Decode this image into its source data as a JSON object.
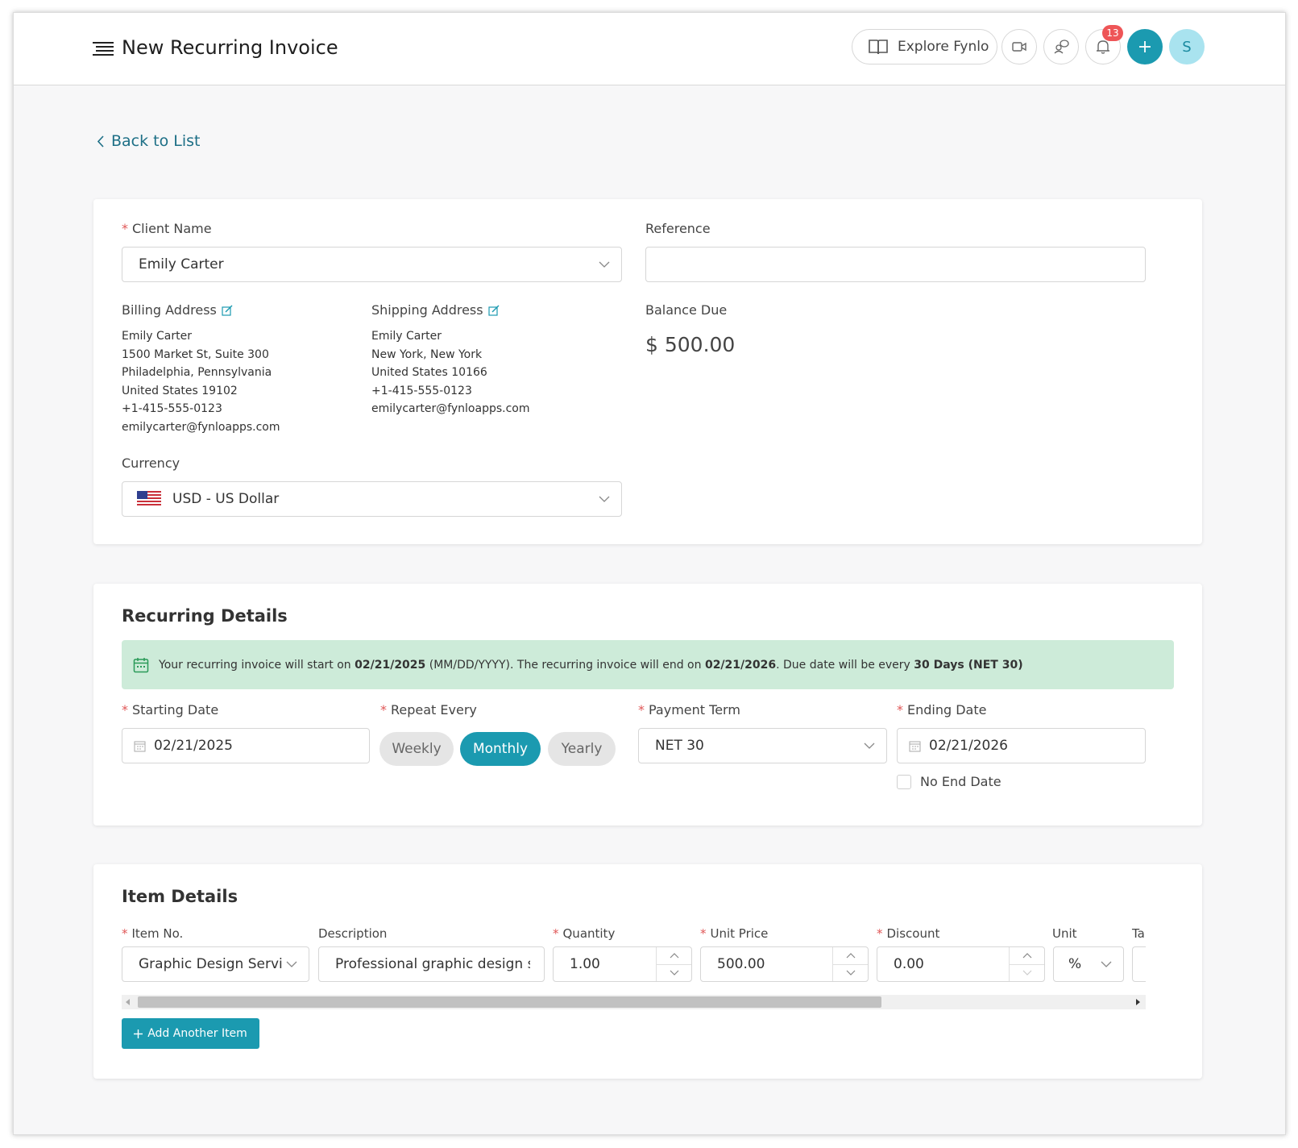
{
  "header": {
    "title": "New Recurring Invoice",
    "explore_label": "Explore Fynlo",
    "notification_count": "13",
    "avatar_initial": "S"
  },
  "nav": {
    "back_label": "Back to List"
  },
  "client": {
    "client_name_label": "Client Name",
    "client_name_value": "Emily Carter",
    "reference_label": "Reference",
    "reference_value": "",
    "billing_label": "Billing Address",
    "billing_lines": [
      "Emily Carter",
      "1500 Market St, Suite 300",
      "Philadelphia, Pennsylvania",
      "United States 19102",
      "+1-415-555-0123",
      "emilycarter@fynloapps.com"
    ],
    "shipping_label": "Shipping Address",
    "shipping_lines": [
      "Emily Carter",
      "New York, New York",
      "United States 10166",
      "+1-415-555-0123",
      "emilycarter@fynloapps.com"
    ],
    "balance_label": "Balance Due",
    "balance_value": "$ 500.00",
    "currency_label": "Currency",
    "currency_value": "USD - US Dollar"
  },
  "recurring": {
    "title": "Recurring Details",
    "notice": {
      "t1": "Your recurring invoice will start on ",
      "start": "02/21/2025",
      "t2": " (MM/DD/YYYY). The recurring invoice will end on ",
      "end": "02/21/2026",
      "t3": ". Due date will be every ",
      "term": "30 Days (NET 30)"
    },
    "starting_date_label": "Starting Date",
    "starting_date_value": "02/21/2025",
    "repeat_label": "Repeat Every",
    "repeat_options": [
      "Weekly",
      "Monthly",
      "Yearly"
    ],
    "repeat_selected": "Monthly",
    "payment_term_label": "Payment Term",
    "payment_term_value": "NET 30",
    "ending_date_label": "Ending Date",
    "ending_date_value": "02/21/2026",
    "no_end_label": "No End Date",
    "no_end_checked": false
  },
  "items": {
    "title": "Item Details",
    "columns": {
      "item_no": "Item No.",
      "description": "Description",
      "quantity": "Quantity",
      "unit_price": "Unit Price",
      "discount": "Discount",
      "unit": "Unit",
      "tax_partial": "Ta"
    },
    "row": {
      "item_no": "Graphic Design Services",
      "description": "Professional graphic design services",
      "quantity": "1.00",
      "unit_price": "500.00",
      "discount": "0.00",
      "unit": "%"
    },
    "scroll_fraction": 0.73,
    "add_label": "Add Another Item"
  },
  "colors": {
    "accent": "#1b9ab0",
    "notice_bg": "#cdebd9",
    "required": "#e05757",
    "badge": "#ee5557"
  },
  "icons": [
    "menu-icon",
    "book-icon",
    "video-icon",
    "support-icon",
    "bell-icon",
    "plus-icon",
    "chevron-left-icon",
    "edit-icon",
    "chevron-down-icon",
    "us-flag-icon",
    "calendar-icon",
    "chevron-up-icon",
    "arrow-left-icon",
    "arrow-right-icon"
  ]
}
